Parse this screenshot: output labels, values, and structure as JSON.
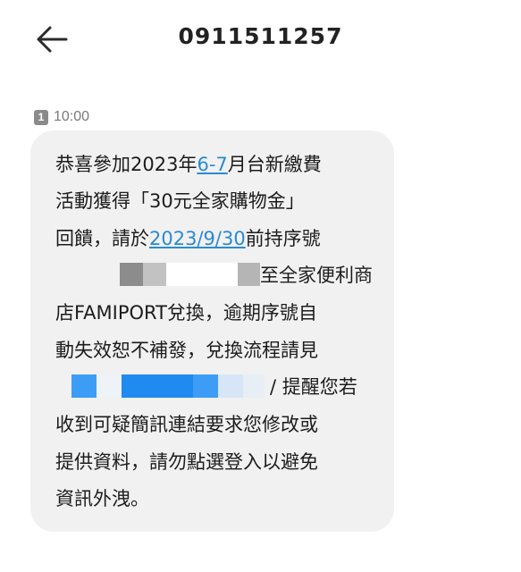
{
  "header": {
    "back_icon": "arrow-left-icon",
    "title": "0911511257"
  },
  "message": {
    "sim_slot": "1",
    "time": "10:00",
    "line1_before": "恭喜參加2023年",
    "line1_link": "6-7",
    "line1_after": "月台新繳費",
    "line2": "活動獲得「30元全家購物金」",
    "line3_before": "回饋，請於",
    "line3_link": "2023/9/30",
    "line3_after": "前持序號",
    "line4_after": "至全家便利商",
    "line5": "店FAMIPORT兌換，逾期序號自",
    "line6": "動失效恕不補發，兌換流程請見",
    "line7_after": "/ 提醒您若",
    "line8": "收到可疑簡訊連結要求您修改或",
    "line9": "提供資料，請勿點選登入以避免",
    "line10": "資訊外洩。"
  },
  "colors": {
    "link": "#2a8ad4",
    "bubble": "#f1f1f1",
    "redaction_gray": "#8c8c8c",
    "redaction_blue": "#3d9cf5"
  }
}
